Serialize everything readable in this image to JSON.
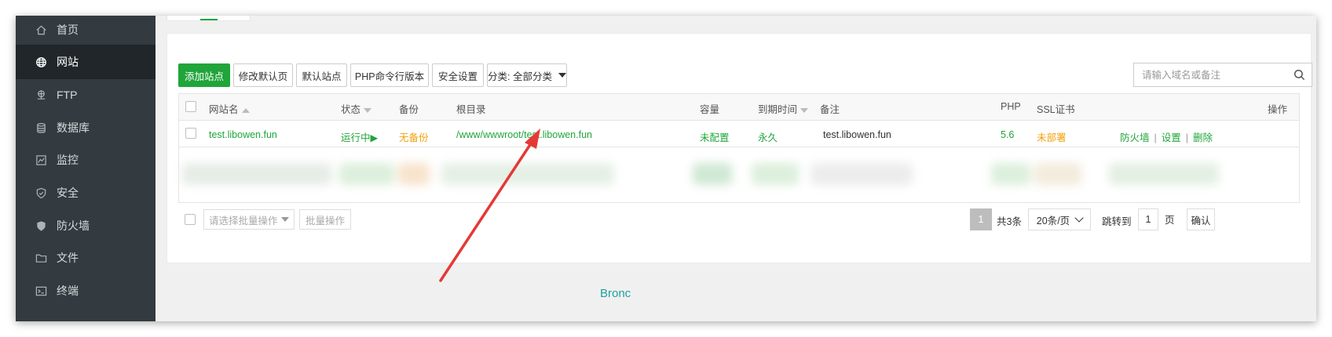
{
  "sidebar": {
    "items": [
      {
        "label": "首页",
        "icon": "home-icon"
      },
      {
        "label": "网站",
        "icon": "globe-icon"
      },
      {
        "label": "FTP",
        "icon": "ftp-icon"
      },
      {
        "label": "数据库",
        "icon": "database-icon"
      },
      {
        "label": "监控",
        "icon": "monitor-icon"
      },
      {
        "label": "安全",
        "icon": "shield-icon"
      },
      {
        "label": "防火墙",
        "icon": "firewall-icon"
      },
      {
        "label": "文件",
        "icon": "folder-icon"
      },
      {
        "label": "终端",
        "icon": "terminal-icon"
      }
    ],
    "active_index": 1
  },
  "toolbar": {
    "add_site": "添加站点",
    "modify_default_page": "修改默认页",
    "default_site": "默认站点",
    "php_cli_version": "PHP命令行版本",
    "security_settings": "安全设置",
    "category_select": "分类: 全部分类"
  },
  "search": {
    "placeholder": "请输入域名或备注"
  },
  "table": {
    "headers": {
      "site_name": "网站名",
      "status": "状态",
      "backup": "备份",
      "root_dir": "根目录",
      "quota": "容量",
      "expire": "到期时间",
      "remark": "备注",
      "php": "PHP",
      "ssl": "SSL证书",
      "actions": "操作"
    },
    "rows": [
      {
        "site_name": "test.libowen.fun",
        "status": "运行中▶",
        "backup": "无备份",
        "root_dir": "/www/wwwroot/test.libowen.fun",
        "quota": "未配置",
        "expire": "永久",
        "remark": "test.libowen.fun",
        "php": "5.6",
        "ssl": "未部署",
        "action_firewall": "防火墙",
        "action_settings": "设置",
        "action_delete": "删除"
      }
    ],
    "separator": "|"
  },
  "footer_bar": {
    "batch_select_placeholder": "请选择批量操作",
    "batch_button": "批量操作",
    "current_page": "1",
    "total": "共3条",
    "page_size": "20条/页",
    "jump_label": "跳转到",
    "jump_value": "1",
    "page_unit": "页",
    "confirm": "确认"
  },
  "watermark_text": "Bronc",
  "colors": {
    "accent": "#20a53a",
    "warning": "#f0a20c",
    "sidebar_bg": "#333b40",
    "annotation_arrow": "#e53935"
  }
}
